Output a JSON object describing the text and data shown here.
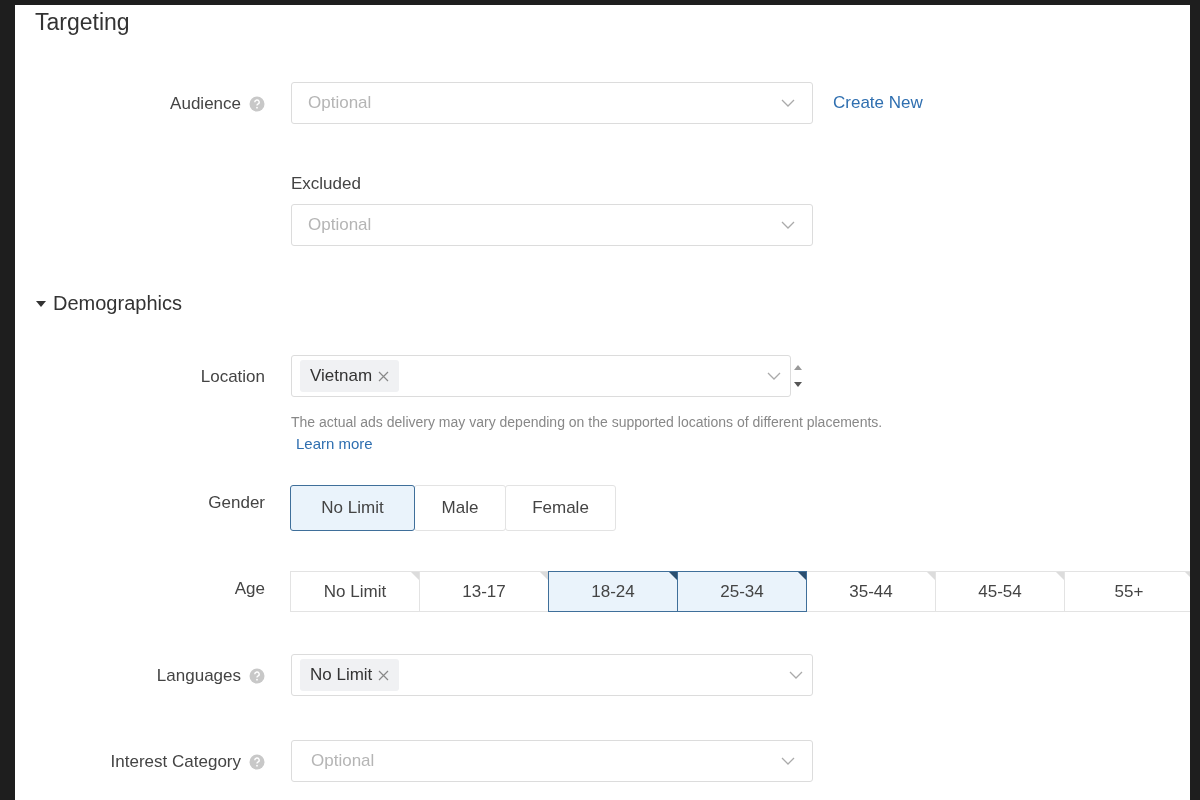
{
  "title": "Targeting",
  "audience": {
    "label": "Audience",
    "help": true,
    "placeholder": "Optional",
    "link": "Create New"
  },
  "excluded": {
    "label": "Excluded",
    "placeholder": "Optional"
  },
  "demographics": {
    "label": "Demographics",
    "expanded": true
  },
  "location": {
    "label": "Location",
    "tags": [
      "Vietnam"
    ],
    "note": "The actual ads delivery may vary depending on the supported locations of different placements.",
    "link": "Learn more"
  },
  "gender": {
    "label": "Gender",
    "options": [
      {
        "label": "No Limit",
        "selected": true
      },
      {
        "label": "Male",
        "selected": false
      },
      {
        "label": "Female",
        "selected": false
      }
    ]
  },
  "age": {
    "label": "Age",
    "options": [
      {
        "label": "No Limit",
        "selected": false
      },
      {
        "label": "13-17",
        "selected": false
      },
      {
        "label": "18-24",
        "selected": true
      },
      {
        "label": "25-34",
        "selected": true
      },
      {
        "label": "35-44",
        "selected": false
      },
      {
        "label": "45-54",
        "selected": false
      },
      {
        "label": "55+",
        "selected": false
      }
    ]
  },
  "languages": {
    "label": "Languages",
    "help": true,
    "tags": [
      "No Limit"
    ]
  },
  "interest_category": {
    "label": "Interest Category",
    "help": true,
    "placeholder": "Optional"
  }
}
